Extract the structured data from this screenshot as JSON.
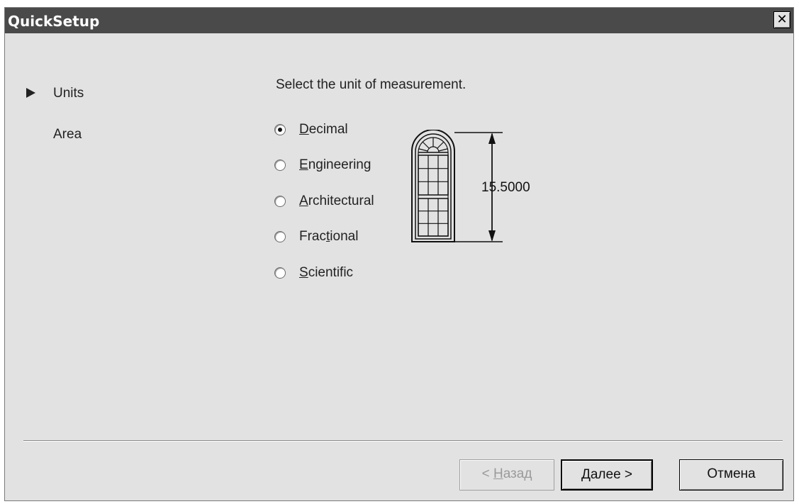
{
  "window": {
    "title": "QuickSetup",
    "close_glyph": "✕"
  },
  "steps": [
    {
      "label": "Units",
      "current": true
    },
    {
      "label": "Area",
      "current": false
    }
  ],
  "prompt": "Select the unit of measurement.",
  "options": [
    {
      "first": "D",
      "rest": "ecimal",
      "selected": true
    },
    {
      "first": "E",
      "rest": "ngineering",
      "selected": false
    },
    {
      "first": "A",
      "rest": "rchitectural",
      "selected": false
    },
    {
      "pre": "Frac",
      "mn": "t",
      "post": "ional",
      "selected": false
    },
    {
      "first": "S",
      "rest": "cientific",
      "selected": false
    }
  ],
  "preview": {
    "icon": "arched-window-icon",
    "dimension": "15.5000"
  },
  "buttons": {
    "back": {
      "prefix": "< ",
      "mn": "Н",
      "rest": "азад",
      "enabled": false
    },
    "next": {
      "mn": "Д",
      "rest": "алее",
      "suffix": " >"
    },
    "cancel": "Отмена"
  }
}
